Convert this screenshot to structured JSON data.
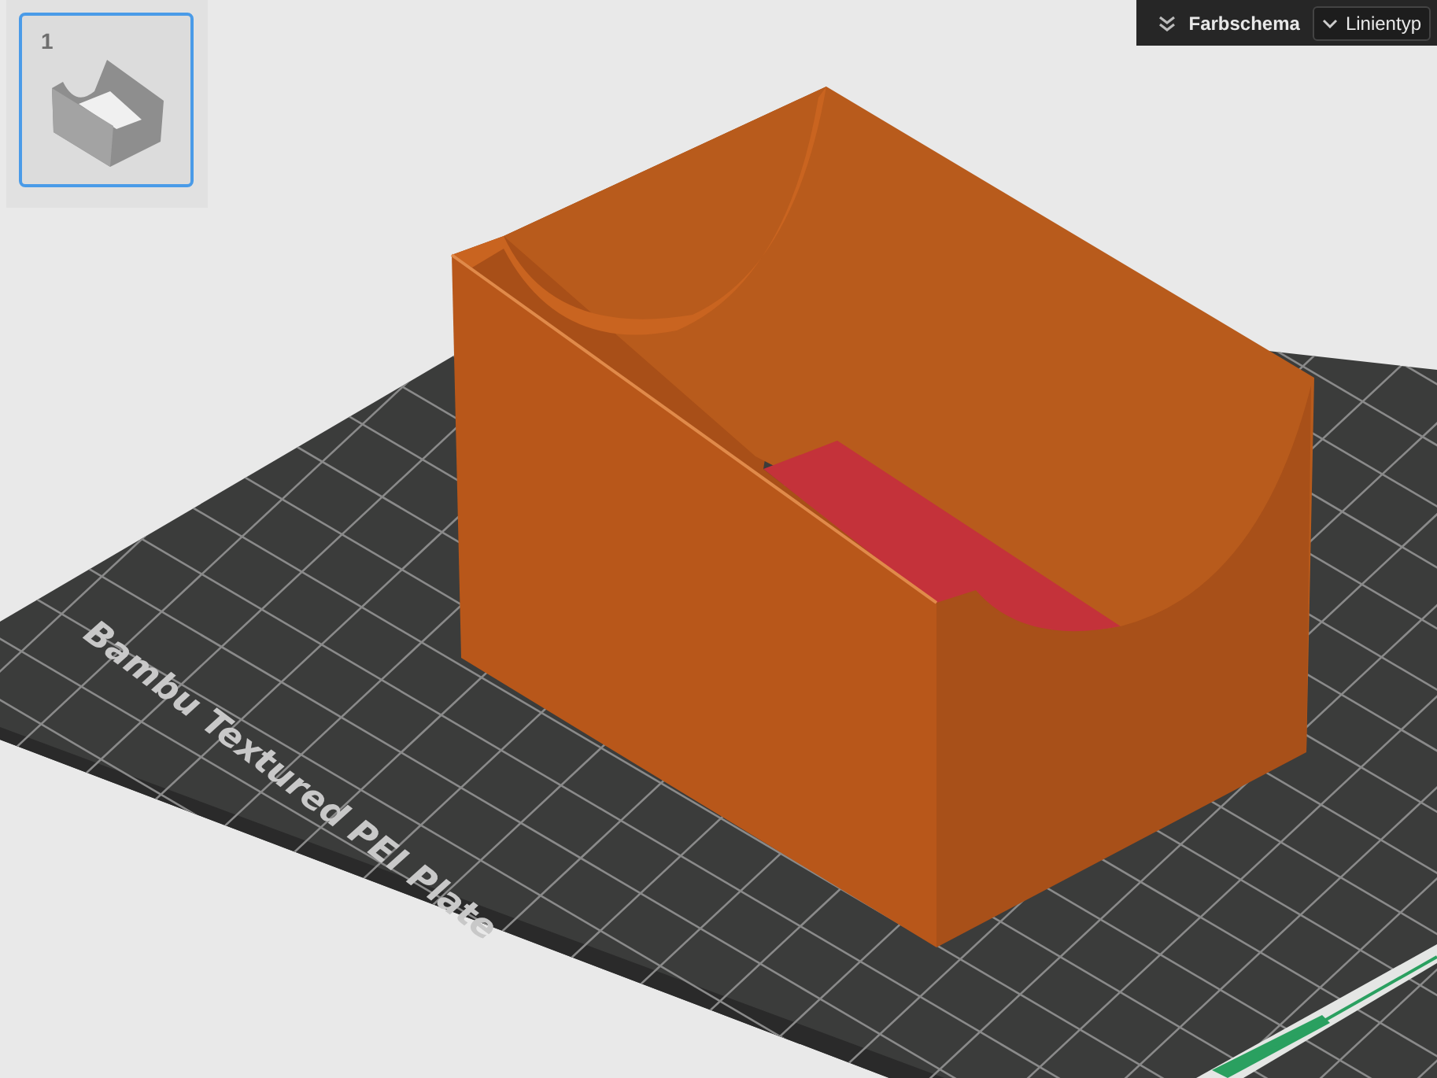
{
  "plate_list": [
    {
      "label": "1",
      "selected": true
    }
  ],
  "toolbar": {
    "items": [
      {
        "kind": "collapse",
        "label": "Farbschema"
      },
      {
        "kind": "dropdown",
        "label": "Linientyp"
      }
    ]
  },
  "viewport": {
    "plate_label": "Bambu Textured PEI Plate"
  }
}
